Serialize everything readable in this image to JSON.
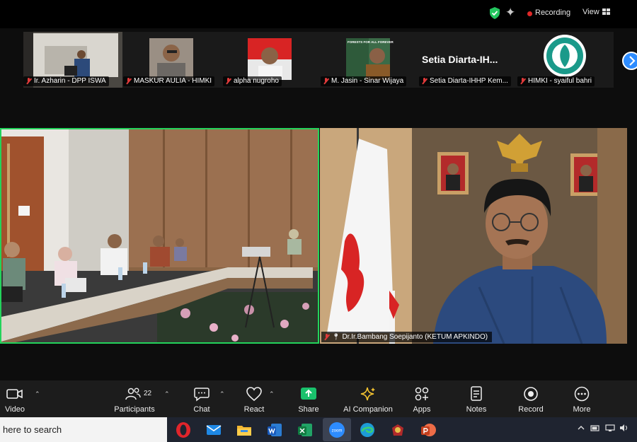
{
  "topbar": {
    "recording_label": "Recording",
    "view_label": "View"
  },
  "filmstrip": [
    {
      "name": "Ir. Azharin - DPP ISWA"
    },
    {
      "name": "MASKUR AULIA - HIMKI"
    },
    {
      "name": "alpha nugroho"
    },
    {
      "name": "M. Jasin - Sinar Wijaya"
    },
    {
      "name": "Setia Diarta-IHHP Kem...",
      "display_text": "Setia  Diarta-IH..."
    },
    {
      "name": "HIMKI - syaiful bahri"
    }
  ],
  "thumb_poster_text": "FORESTS FOR ALL FOREVER",
  "main": {
    "right_speaker_name": "Dr.Ir.Bambang Soepijanto (KETUM APKINDO)"
  },
  "toolbar": {
    "video": "Video",
    "participants": "Participants",
    "participants_count": "22",
    "chat": "Chat",
    "react": "React",
    "share": "Share",
    "ai_companion": "AI Companion",
    "apps": "Apps",
    "notes": "Notes",
    "record": "Record",
    "more": "More"
  },
  "taskbar": {
    "search_text": "here to search",
    "zoom_label": "zoom"
  },
  "colors": {
    "active_speaker_border": "#23d35b",
    "share_green": "#19c16c",
    "recording_red": "#e02828",
    "accent_blue": "#2d8cff"
  }
}
